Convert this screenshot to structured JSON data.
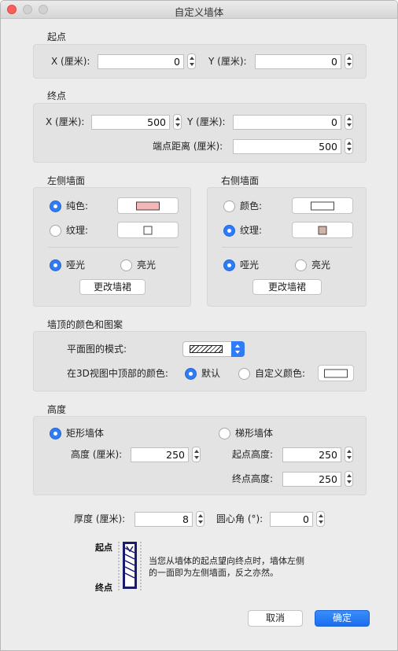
{
  "window": {
    "title": "自定义墙体"
  },
  "start_point": {
    "title": "起点",
    "x_label": "X (厘米):",
    "x_value": "0",
    "y_label": "Y (厘米):",
    "y_value": "0"
  },
  "end_point": {
    "title": "终点",
    "x_label": "X (厘米):",
    "x_value": "500",
    "y_label": "Y (厘米):",
    "y_value": "0",
    "distance_label": "端点距离 (厘米):",
    "distance_value": "500"
  },
  "left_wall": {
    "title": "左侧墙面",
    "color_label": "纯色:",
    "color_selected": true,
    "color_swatch": "#f4b6b6",
    "texture_label": "纹理:",
    "texture_selected": false,
    "texture_swatch": "#ffffff",
    "matte_label": "哑光",
    "matte_selected": true,
    "gloss_label": "亮光",
    "gloss_selected": false,
    "baseboard_button": "更改墙裙"
  },
  "right_wall": {
    "title": "右侧墙面",
    "color_label": "颜色:",
    "color_selected": false,
    "color_swatch": "#ffffff",
    "texture_label": "纹理:",
    "texture_selected": true,
    "texture_swatch": "#d1b4a5",
    "matte_label": "哑光",
    "matte_selected": true,
    "gloss_label": "亮光",
    "gloss_selected": false,
    "baseboard_button": "更改墙裙"
  },
  "top": {
    "title": "墙顶的颜色和图案",
    "plan_mode_label": "平面图的模式:",
    "pattern_icon": "hatch-pattern",
    "color_3d_label": "在3D视图中顶部的颜色:",
    "default_label": "默认",
    "default_selected": true,
    "custom_label": "自定义颜色:",
    "custom_selected": false,
    "custom_swatch": "#ffffff"
  },
  "height": {
    "title": "高度",
    "rect_label": "矩形墙体",
    "rect_selected": true,
    "trap_label": "梯形墙体",
    "trap_selected": false,
    "height_label": "高度 (厘米):",
    "height_value": "250",
    "start_height_label": "起点高度:",
    "start_height_value": "250",
    "end_height_label": "终点高度:",
    "end_height_value": "250"
  },
  "thickness": {
    "label": "厚度 (厘米):",
    "value": "8",
    "arc_label": "圆心角 (°):",
    "arc_value": "0"
  },
  "legend": {
    "start": "起点",
    "end": "终点",
    "hint_line1": "当您从墙体的起点望向终点时，墙体左侧",
    "hint_line2": "的一面即为左侧墙面，反之亦然。",
    "wall_color": "#1a1a6e"
  },
  "buttons": {
    "cancel": "取消",
    "ok": "确定"
  },
  "colors": {
    "accent": "#2f7cf6",
    "close": "#fc5f57"
  }
}
